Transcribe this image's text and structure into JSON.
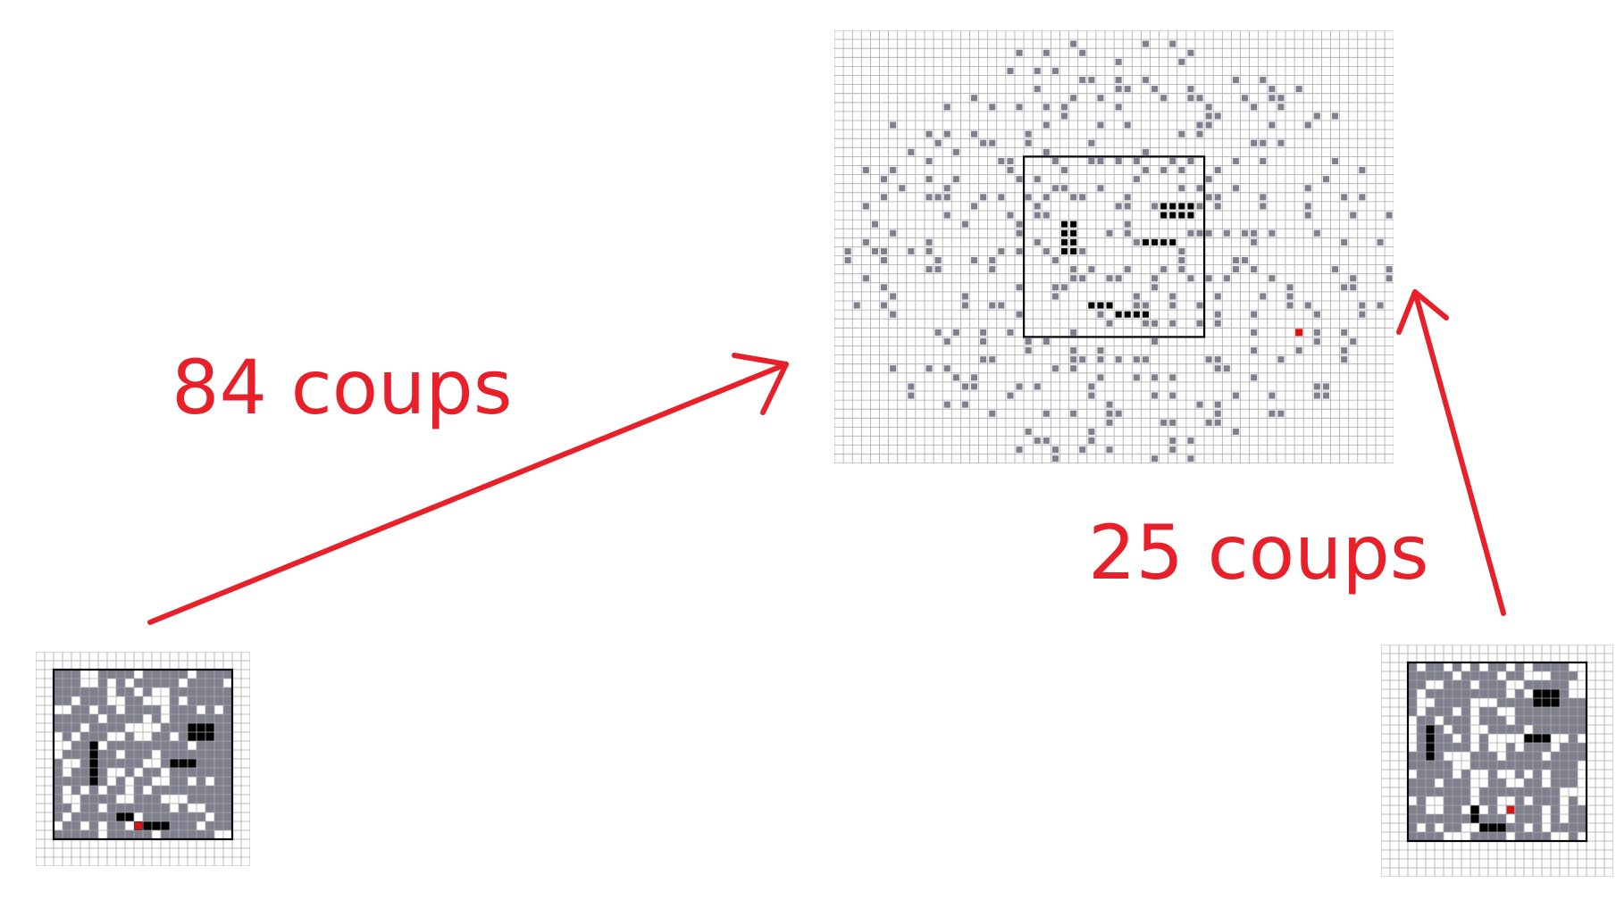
{
  "labels": {
    "left_moves": "84 coups",
    "right_moves": "25 coups"
  },
  "colors": {
    "arrow": "#e8202a",
    "grid_line": "#a9a9a9",
    "gray_cell": "#7f7f8e",
    "black_block": "#000000",
    "player_marker": "#e01010",
    "frame": "#000000"
  },
  "boards": {
    "start_left": {
      "state": "initial",
      "cols": 24,
      "rows": 24,
      "frame_cols": [
        2,
        22
      ],
      "frame_rows": [
        2,
        21
      ],
      "gray_fill_density": 0.72,
      "black_blocks": [
        [
          17,
          8
        ],
        [
          18,
          8
        ],
        [
          19,
          8
        ],
        [
          17,
          9
        ],
        [
          18,
          9
        ],
        [
          19,
          9
        ],
        [
          6,
          10
        ],
        [
          6,
          11
        ],
        [
          6,
          12
        ],
        [
          6,
          13
        ],
        [
          6,
          14
        ],
        [
          15,
          12
        ],
        [
          16,
          12
        ],
        [
          17,
          12
        ],
        [
          9,
          18
        ],
        [
          10,
          18
        ],
        [
          11,
          19
        ],
        [
          12,
          19
        ],
        [
          13,
          19
        ],
        [
          14,
          19
        ]
      ],
      "player": [
        11,
        19
      ]
    },
    "center": {
      "state": "intermediate",
      "cols": 62,
      "rows": 48,
      "frame_cols": [
        21,
        41
      ],
      "frame_rows": [
        14,
        34
      ],
      "gray_fill_density": 0.11,
      "black_blocks": [
        [
          36,
          19
        ],
        [
          37,
          19
        ],
        [
          38,
          19
        ],
        [
          39,
          19
        ],
        [
          36,
          20
        ],
        [
          37,
          20
        ],
        [
          38,
          20
        ],
        [
          39,
          20
        ],
        [
          25,
          21
        ],
        [
          26,
          21
        ],
        [
          25,
          22
        ],
        [
          26,
          22
        ],
        [
          25,
          23
        ],
        [
          26,
          23
        ],
        [
          25,
          24
        ],
        [
          26,
          24
        ],
        [
          34,
          23
        ],
        [
          35,
          23
        ],
        [
          36,
          23
        ],
        [
          37,
          23
        ],
        [
          28,
          30
        ],
        [
          29,
          30
        ],
        [
          30,
          30
        ],
        [
          31,
          31
        ],
        [
          32,
          31
        ],
        [
          33,
          31
        ],
        [
          34,
          31
        ]
      ],
      "player": [
        51,
        33
      ]
    },
    "start_right": {
      "state": "initial",
      "cols": 26,
      "rows": 26,
      "frame_cols": [
        3,
        23
      ],
      "frame_rows": [
        2,
        22
      ],
      "gray_fill_density": 0.7,
      "black_blocks": [
        [
          17,
          5
        ],
        [
          18,
          5
        ],
        [
          19,
          5
        ],
        [
          17,
          6
        ],
        [
          18,
          6
        ],
        [
          19,
          6
        ],
        [
          5,
          9
        ],
        [
          5,
          10
        ],
        [
          5,
          11
        ],
        [
          5,
          12
        ],
        [
          16,
          10
        ],
        [
          17,
          10
        ],
        [
          18,
          10
        ],
        [
          10,
          18
        ],
        [
          10,
          19
        ],
        [
          11,
          20
        ],
        [
          12,
          20
        ],
        [
          13,
          20
        ]
      ],
      "player": [
        14,
        18
      ]
    }
  },
  "arrows": [
    {
      "from": "start_left",
      "to": "center",
      "label": "84 coups"
    },
    {
      "from": "start_right",
      "to": "center",
      "label": "25 coups"
    }
  ]
}
